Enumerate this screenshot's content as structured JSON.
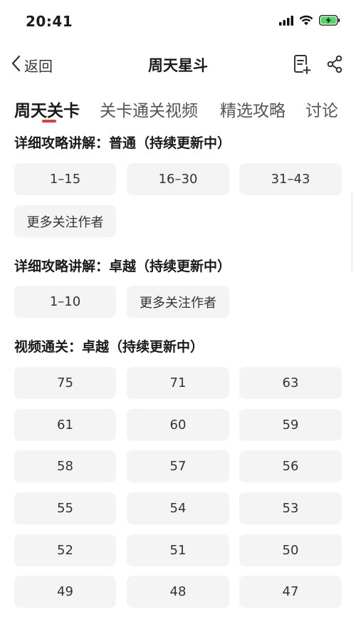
{
  "status": {
    "time": "20:41"
  },
  "nav": {
    "back_label": "返回",
    "title": "周天星斗"
  },
  "tabs": [
    {
      "label": "周天关卡"
    },
    {
      "label": "关卡通关视频"
    },
    {
      "label": "精选攻略"
    },
    {
      "label": "讨论"
    }
  ],
  "sections": [
    {
      "title": "详细攻略讲解：普通（持续更新中）",
      "items": [
        "1–15",
        "16–30",
        "31–43",
        "更多关注作者"
      ]
    },
    {
      "title": "详细攻略讲解：卓越（持续更新中）",
      "items": [
        "1–10",
        "更多关注作者"
      ]
    },
    {
      "title": "视频通关：卓越（持续更新中）",
      "items": [
        "75",
        "71",
        "63",
        "61",
        "60",
        "59",
        "58",
        "57",
        "56",
        "55",
        "54",
        "53",
        "52",
        "51",
        "50",
        "49",
        "48",
        "47"
      ]
    }
  ]
}
